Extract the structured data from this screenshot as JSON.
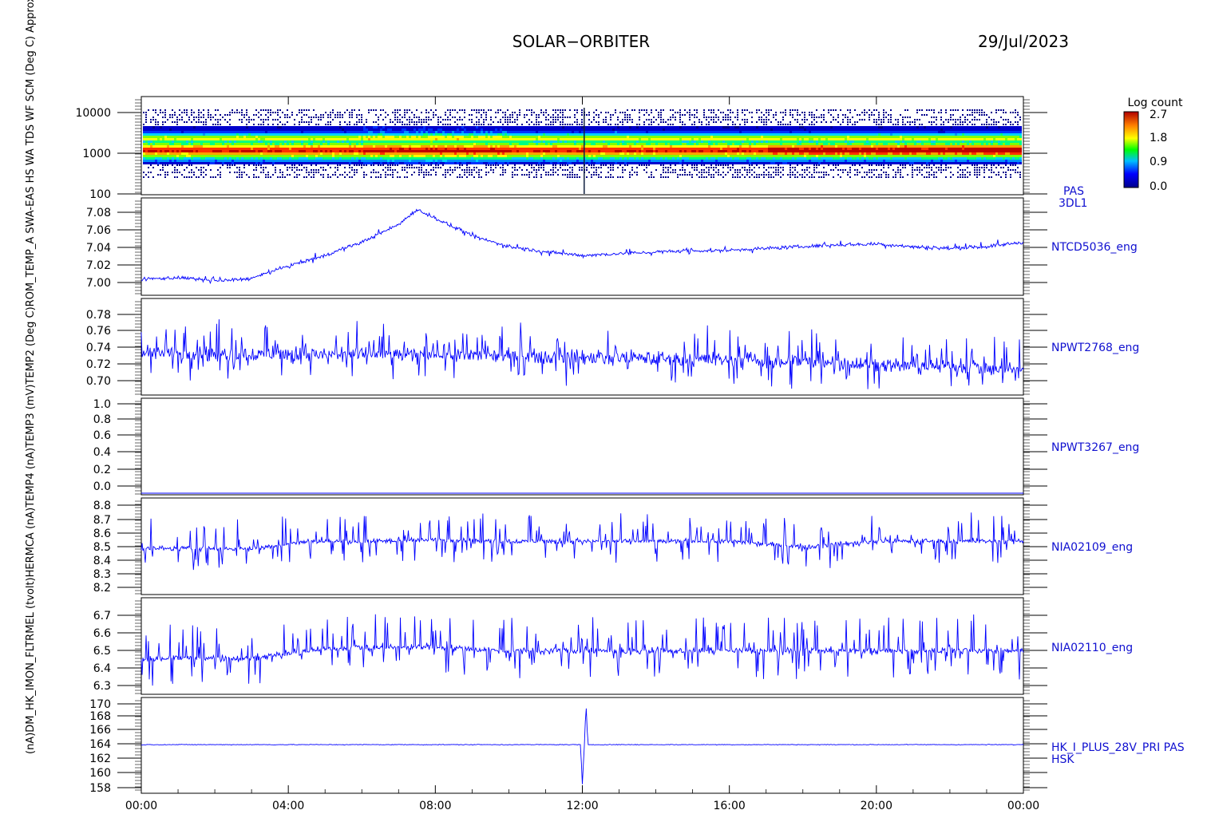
{
  "header": {
    "mission": "SOLAR−ORBITER",
    "date": "29/Jul/2023"
  },
  "x_ticks": [
    "00:00",
    "04:00",
    "08:00",
    "12:00",
    "16:00",
    "20:00",
    "00:00"
  ],
  "stacked_ylabel": "(nA)DM_HK_IMON_FLTRMEL (tvolt)HERMCA (nA)TEMP4 (nA)TEMP3 (mV)TEMP2 (Deg C)ROM_TEMP_A SWA-EAS HS WA TDS WF SCM (Deg C) Approx Temp (Deg C)(eV)",
  "colorbar": {
    "title": "Log count",
    "ticks": [
      "2.7",
      "1.8",
      "0.9",
      "0.0"
    ],
    "max": 2.7,
    "min": 0.0
  },
  "panels": [
    {
      "id": "spectrogram",
      "label_1": "PAS",
      "label_2": "3DL1",
      "y_ticks": [
        "10000",
        "1000",
        "100"
      ],
      "scale": "log",
      "ylim": [
        100,
        20000
      ]
    },
    {
      "id": "ntcd5036",
      "label": "NTCD5036_eng",
      "y_ticks": [
        "7.08",
        "7.06",
        "7.04",
        "7.02",
        "7.00"
      ],
      "ylim": [
        6.985,
        7.095
      ]
    },
    {
      "id": "npwt2768",
      "label": "NPWT2768_eng",
      "y_ticks": [
        "0.78",
        "0.76",
        "0.74",
        "0.72",
        "0.70"
      ],
      "ylim": [
        0.688,
        0.795
      ]
    },
    {
      "id": "npwt3267",
      "label": "NPWT3267_eng",
      "y_ticks": [
        "1.0",
        "0.8",
        "0.6",
        "0.4",
        "0.2",
        "0.0"
      ],
      "ylim": [
        0.0,
        1.0
      ]
    },
    {
      "id": "nia02109",
      "label": "NIA02109_eng",
      "y_ticks": [
        "8.8",
        "8.7",
        "8.6",
        "8.5",
        "8.4",
        "8.3",
        "8.2"
      ],
      "ylim": [
        8.15,
        8.82
      ]
    },
    {
      "id": "nia02110",
      "label": "NIA02110_eng",
      "y_ticks": [
        "6.7",
        "6.6",
        "6.5",
        "6.4",
        "6.3"
      ],
      "ylim": [
        6.27,
        6.78
      ]
    },
    {
      "id": "hk_i_plus",
      "label_1": "HK_I_PLUS_28V_PRI PAS",
      "label_2": "HSK",
      "y_ticks": [
        "170",
        "168",
        "166",
        "164",
        "162",
        "160",
        "158"
      ],
      "ylim": [
        157,
        170
      ]
    }
  ],
  "chart_data": {
    "type": "line",
    "title": "SOLAR−ORBITER",
    "date": "29/Jul/2023",
    "x_range_hours": [
      0,
      24
    ],
    "x_tick_labels": [
      "00:00",
      "04:00",
      "08:00",
      "12:00",
      "16:00",
      "20:00",
      "00:00"
    ],
    "series": [
      {
        "name": "NTCD5036_eng",
        "x_hours": [
          0,
          1,
          2,
          3,
          4,
          5,
          6,
          7,
          7.5,
          8,
          9,
          10,
          11,
          12,
          13,
          14,
          15,
          16,
          17,
          18,
          19,
          20,
          21,
          22,
          23,
          24
        ],
        "values": [
          7.003,
          7.005,
          7.001,
          7.004,
          7.018,
          7.03,
          7.045,
          7.065,
          7.082,
          7.072,
          7.052,
          7.04,
          7.034,
          7.03,
          7.032,
          7.034,
          7.035,
          7.036,
          7.038,
          7.04,
          7.042,
          7.043,
          7.04,
          7.038,
          7.04,
          7.045
        ]
      },
      {
        "name": "NPWT2768_eng",
        "x_hours": [
          0,
          4,
          8,
          12,
          16,
          20,
          24
        ],
        "values": [
          0.735,
          0.733,
          0.733,
          0.73,
          0.727,
          0.722,
          0.717
        ]
      },
      {
        "name": "NPWT3267_eng",
        "x_hours": [
          0,
          24
        ],
        "values": [
          0.0,
          0.0
        ]
      },
      {
        "name": "NIA02109_eng",
        "x_hours": [
          0,
          3,
          4.5,
          6,
          8,
          10,
          12,
          16,
          18,
          20,
          24
        ],
        "values": [
          8.47,
          8.47,
          8.52,
          8.52,
          8.53,
          8.52,
          8.52,
          8.52,
          8.48,
          8.52,
          8.52
        ]
      },
      {
        "name": "NIA02110_eng",
        "x_hours": [
          0,
          3,
          4.5,
          6,
          8,
          10,
          12,
          16,
          20,
          24
        ],
        "values": [
          6.46,
          6.46,
          6.5,
          6.52,
          6.52,
          6.5,
          6.5,
          6.5,
          6.5,
          6.5
        ]
      },
      {
        "name": "HK_I_PLUS_28V_PRI PAS HSK",
        "x_hours": [
          0,
          11.95,
          12.0,
          12.05,
          12.1,
          12.15,
          24
        ],
        "values": [
          163.6,
          163.6,
          158.2,
          163.0,
          169.2,
          163.6,
          163.6
        ]
      }
    ],
    "spectrogram": {
      "name": "PAS 3DL1",
      "ylabel": "(eV)",
      "scale": "log",
      "peak_energy_eV": 1000,
      "secondary_band_eV": 2000,
      "range_eV": [
        300,
        9000
      ]
    }
  }
}
